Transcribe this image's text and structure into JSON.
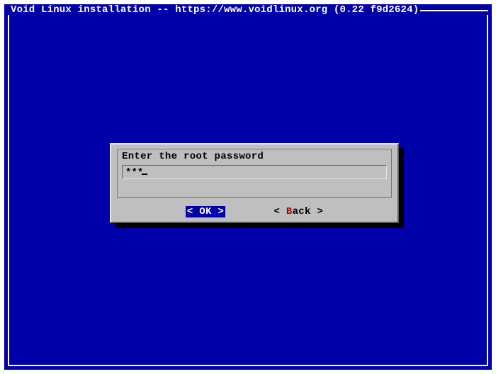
{
  "window": {
    "title": "Void Linux installation -- https://www.voidlinux.org (0.22 f9d2624)"
  },
  "dialog": {
    "prompt": "Enter the root password",
    "password_masked": "***",
    "buttons": {
      "ok": {
        "left": "<",
        "hot": " O",
        "rest": "K ",
        "right": ">"
      },
      "back": {
        "left": "< ",
        "hot": "B",
        "rest": "ack ",
        "right": ">"
      }
    }
  },
  "colors": {
    "background": "#0000a8",
    "dialog_bg": "#bfbfbf",
    "highlight": "#0000a8",
    "hotkey": "#a80000"
  }
}
